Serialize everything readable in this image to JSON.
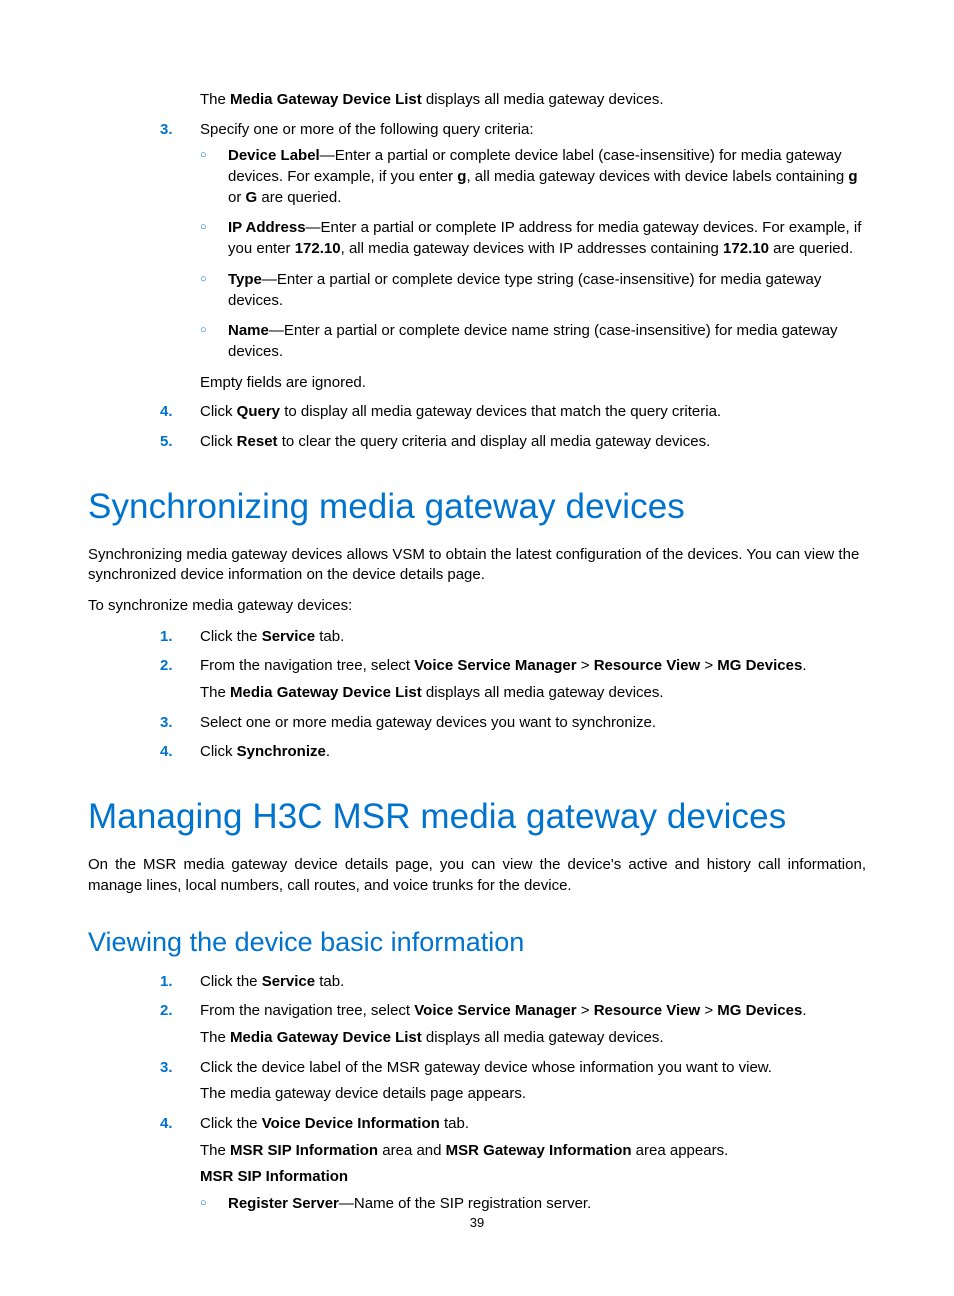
{
  "page_number": "39",
  "intro_line": {
    "pre": "The ",
    "bold": "Media Gateway Device List",
    "post": " displays all media gateway devices."
  },
  "step3": {
    "num": "3.",
    "intro": "Specify one or more of the following query criteria:",
    "items": [
      {
        "label": "Device Label",
        "sep": "—Enter a partial or complete device label (case-insensitive) for media gateway devices. For example, if you enter ",
        "b2": "g",
        "mid": ", all media gateway devices with device labels containing ",
        "b3": "g",
        "mid2": " or ",
        "b4": "G",
        "end": " are queried."
      },
      {
        "label": "IP Address",
        "sep": "—Enter a partial or complete IP address for media gateway devices. For example, if you enter ",
        "b2": "172.10",
        "mid": ", all media gateway devices with IP addresses containing ",
        "b3": "172.10",
        "end": " are queried."
      },
      {
        "label": "Type",
        "sep": "—Enter a partial or complete device type string (case-insensitive) for media gateway devices.",
        "end": ""
      },
      {
        "label": "Name",
        "sep": "—Enter a partial or complete device name string (case-insensitive) for media gateway devices.",
        "end": ""
      }
    ],
    "tail": "Empty fields are ignored."
  },
  "step4": {
    "num": "4.",
    "pre": "Click ",
    "bold": "Query",
    "post": " to display all media gateway devices that match the query criteria."
  },
  "step5": {
    "num": "5.",
    "pre": "Click ",
    "bold": "Reset",
    "post": " to clear the query criteria and display all media gateway devices."
  },
  "sync": {
    "title": "Synchronizing media gateway devices",
    "para1": "Synchronizing media gateway devices allows VSM to obtain the latest configuration of the devices. You can view the synchronized device information on the device details page.",
    "para2": "To synchronize media gateway devices:",
    "steps": [
      {
        "num": "1.",
        "pre": "Click the ",
        "bold": "Service",
        "post": " tab."
      },
      {
        "num": "2.",
        "line1_pre": "From the navigation tree, select ",
        "b1": "Voice Service Manager",
        "gt1": " > ",
        "b2": "Resource View",
        "gt2": " > ",
        "b3": "MG Devices",
        "dot": ".",
        "line2_pre": "The ",
        "line2_bold": "Media Gateway Device List",
        "line2_post": " displays all media gateway devices."
      },
      {
        "num": "3.",
        "pre": "Select one or more media gateway devices you want to synchronize.",
        "bold": "",
        "post": ""
      },
      {
        "num": "4.",
        "pre": "Click ",
        "bold": "Synchronize",
        "post": "."
      }
    ]
  },
  "msr": {
    "title": "Managing H3C MSR media gateway devices",
    "para1": "On the MSR media gateway device details page, you can view the device's active and history call information, manage lines, local numbers, call routes, and voice trunks for the device.",
    "sub_title": "Viewing the device basic information",
    "steps": [
      {
        "num": "1.",
        "pre": "Click the ",
        "bold": "Service",
        "post": " tab."
      },
      {
        "num": "2.",
        "line1_pre": "From the navigation tree, select ",
        "b1": "Voice Service Manager",
        "gt1": " > ",
        "b2": "Resource View",
        "gt2": " > ",
        "b3": "MG Devices",
        "dot": ".",
        "line2_pre": "The ",
        "line2_bold": "Media Gateway Device List",
        "line2_post": " displays all media gateway devices."
      },
      {
        "num": "3.",
        "line1": "Click the device label of the MSR gateway device whose information you want to view.",
        "line2": "The media gateway device details page appears."
      },
      {
        "num": "4.",
        "l1_pre": "Click the ",
        "l1_bold": "Voice Device Information",
        "l1_post": " tab.",
        "l2_pre": "The ",
        "l2_b1": "MSR SIP Information",
        "l2_mid": " area and ",
        "l2_b2": "MSR Gateway Information",
        "l2_post": " area appears.",
        "l3_bold": "MSR SIP Information",
        "bullets": [
          {
            "label": "Register Server",
            "text": "—Name of the SIP registration server."
          }
        ]
      }
    ]
  }
}
